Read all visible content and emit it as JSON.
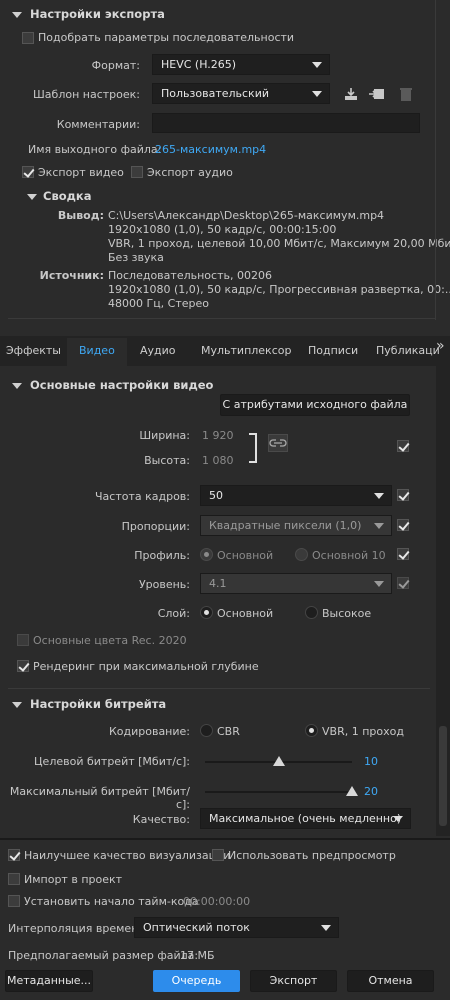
{
  "export_settings": {
    "title": "Настройки экспорта",
    "match_sequence_label": "Подобрать параметры последовательности",
    "format_label": "Формат:",
    "format_value": "HEVC (H.265)",
    "preset_label": "Шаблон настроек:",
    "preset_value": "Пользовательский",
    "comments_label": "Комментарии:",
    "comments_value": "",
    "output_name_label": "Имя выходного файла:",
    "output_name_value": "265-максимум.mp4",
    "export_video_label": "Экспорт видео",
    "export_audio_label": "Экспорт аудио"
  },
  "summary": {
    "title": "Сводка",
    "output_label": "Вывод:",
    "output_lines": [
      "C:\\Users\\Александр\\Desktop\\265-максимум.mp4",
      "1920x1080 (1,0), 50 кадр/с, 00:00:15:00",
      "VBR, 1 проход, целевой 10,00 Мбит/с, Максимум 20,00 Мби...",
      "Без звука"
    ],
    "source_label": "Источник:",
    "source_lines": [
      "Последовательность, 00206",
      "1920x1080 (1,0), 50 кадр/с, Прогрессивная развертка, 00:...",
      "48000 Гц, Стерео"
    ]
  },
  "tabs": [
    {
      "label": "Эффекты"
    },
    {
      "label": "Видео"
    },
    {
      "label": "Аудио"
    },
    {
      "label": "Мультиплексор"
    },
    {
      "label": "Подписи"
    },
    {
      "label": "Публикаци"
    }
  ],
  "tabs_more": "»",
  "video": {
    "title": "Основные настройки видео",
    "match_source_button": "С атрибутами исходного файла",
    "width_label": "Ширина:",
    "width_value": "1 920",
    "height_label": "Высота:",
    "height_value": "1 080",
    "fps_label": "Частота кадров:",
    "fps_value": "50",
    "aspect_label": "Пропорции:",
    "aspect_value": "Квадратные пиксели (1,0)",
    "profile_label": "Профиль:",
    "profile_main": "Основной",
    "profile_main10": "Основной 10",
    "level_label": "Уровень:",
    "level_value": "4.1",
    "tier_label": "Слой:",
    "tier_main": "Основной",
    "tier_high": "Высокое",
    "rec2020_label": "Основные цвета Rec. 2020",
    "max_depth_label": "Рендеринг при максимальной глубине"
  },
  "bitrate": {
    "title": "Настройки битрейта",
    "encoding_label": "Кодирование:",
    "cbr": "CBR",
    "vbr": "VBR, 1 проход",
    "target_label": "Целевой битрейт [Мбит/с]:",
    "target_value": "10",
    "target_fraction": 0.5,
    "max_label": "Максимальный битрейт [Мбит/с]:",
    "max_value": "20",
    "max_fraction": 1.0,
    "quality_label": "Качество:",
    "quality_value": "Максимальное (очень медленно)"
  },
  "footer": {
    "best_quality_label": "Наилучшее качество визуализации",
    "use_previews_label": "Использовать предпросмотр",
    "import_project_label": "Импорт в проект",
    "set_timecode_label": "Установить начало тайм-кода",
    "timecode_value": "00:00:00:00",
    "time_interp_label": "Интерполяция времени:",
    "time_interp_value": "Оптический поток",
    "file_size_label": "Предполагаемый размер файла:",
    "file_size_value": "17 МБ",
    "metadata_button": "Метаданные...",
    "queue_button": "Очередь",
    "export_button": "Экспорт",
    "cancel_button": "Отмена"
  },
  "colors": {
    "accent": "#2d8ceb",
    "link": "#3fa9f5",
    "background": "#2b2b2b"
  }
}
